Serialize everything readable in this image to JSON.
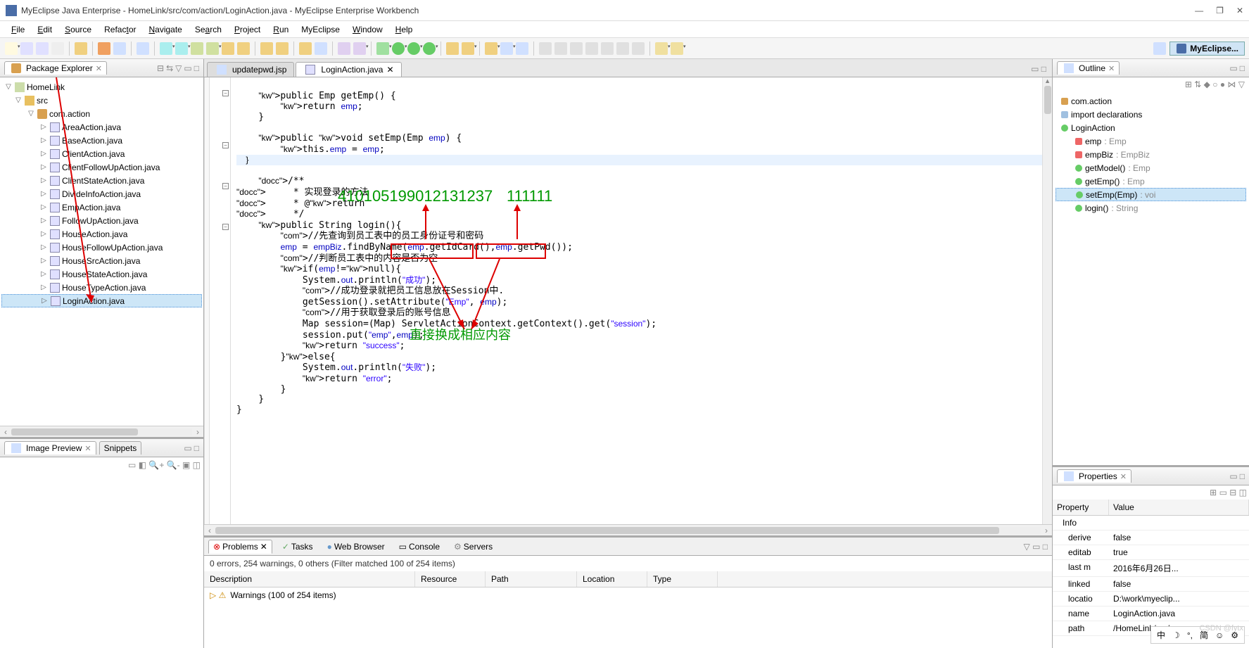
{
  "window": {
    "title": "MyEclipse Java Enterprise - HomeLink/src/com/action/LoginAction.java - MyEclipse Enterprise Workbench",
    "min": "—",
    "max": "❐",
    "close": "✕"
  },
  "menu": [
    "File",
    "Edit",
    "Source",
    "Refactor",
    "Navigate",
    "Search",
    "Project",
    "Run",
    "MyEclipse",
    "Window",
    "Help"
  ],
  "perspective_label": "MyEclipse...",
  "package_explorer": {
    "title": "Package Explorer",
    "project": "HomeLink",
    "src": "src",
    "pkg": "com.action",
    "files": [
      "AreaAction.java",
      "BaseAction.java",
      "ClientAction.java",
      "ClientFollowUpAction.java",
      "ClientStateAction.java",
      "DivideInfoAction.java",
      "EmpAction.java",
      "FollowUpAction.java",
      "HouseAction.java",
      "HouseFollowUpAction.java",
      "HouseSrcAction.java",
      "HouseStateAction.java",
      "HouseTypeAction.java",
      "LoginAction.java"
    ]
  },
  "image_preview": {
    "title": "Image Preview",
    "snippets": "Snippets"
  },
  "editor_tabs": [
    {
      "label": "updatepwd.jsp",
      "active": false
    },
    {
      "label": "LoginAction.java",
      "active": true
    }
  ],
  "code": {
    "lines": [
      "",
      "    public Emp getEmp() {",
      "        return emp;",
      "    }",
      "",
      "    public void setEmp(Emp emp) {",
      "        this.emp = emp;",
      "    }",
      "",
      "    /**",
      "     * 实现登录的方法",
      "     * @return",
      "     */",
      "    public String login(){",
      "        //先查询到员工表中的员工身份证号和密码",
      "        emp = empBiz.findByName(emp.getIdCard(),emp.getPwd());",
      "        //判断员工表中的内容是否为空",
      "        if(emp!=null){",
      "            System.out.println(\"成功\");",
      "            //成功登录就把员工信息放在Session中.",
      "            getSession().setAttribute(\"Emp\", emp);",
      "            //用于获取登录后的账号信息",
      "            Map session=(Map) ServletActionContext.getContext().get(\"session\");",
      "            session.put(\"emp\",emp);",
      "            return \"success\";",
      "        }else{",
      "            System.out.println(\"失败\");",
      "            return \"error\";",
      "        }",
      "    }",
      "}",
      ""
    ]
  },
  "annotations": {
    "num1": "410105199012131237",
    "num2": "111111",
    "text": "直接换成相应内容"
  },
  "problems": {
    "tabs": [
      "Problems",
      "Tasks",
      "Web Browser",
      "Console",
      "Servers"
    ],
    "summary": "0 errors, 254 warnings, 0 others (Filter matched 100 of 254 items)",
    "cols": [
      "Description",
      "Resource",
      "Path",
      "Location",
      "Type"
    ],
    "row1": "Warnings (100 of 254 items)"
  },
  "outline": {
    "title": "Outline",
    "items": [
      {
        "icon": "pkg",
        "label": "com.action",
        "indent": 0
      },
      {
        "icon": "imp",
        "label": "import declarations",
        "indent": 0
      },
      {
        "icon": "cls",
        "label": "LoginAction",
        "indent": 0
      },
      {
        "icon": "fld",
        "label": "emp",
        "suffix": ": Emp",
        "indent": 1
      },
      {
        "icon": "fld",
        "label": "empBiz",
        "suffix": ": EmpBiz",
        "indent": 1
      },
      {
        "icon": "mth",
        "label": "getModel()",
        "suffix": ": Emp",
        "indent": 1
      },
      {
        "icon": "mth",
        "label": "getEmp()",
        "suffix": ": Emp",
        "indent": 1
      },
      {
        "icon": "mth",
        "label": "setEmp(Emp)",
        "suffix": ": voi",
        "indent": 1,
        "sel": true
      },
      {
        "icon": "mth",
        "label": "login()",
        "suffix": ": String",
        "indent": 1
      }
    ]
  },
  "properties": {
    "title": "Properties",
    "cols": [
      "Property",
      "Value"
    ],
    "info": "Info",
    "rows": [
      [
        "derive",
        "false"
      ],
      [
        "editab",
        "true"
      ],
      [
        "last m",
        "2016年6月26日..."
      ],
      [
        "linked",
        "false"
      ],
      [
        "locatio",
        "D:\\work\\myeclip..."
      ],
      [
        "name",
        "LoginAction.java"
      ],
      [
        "path",
        "/HomeLink/src/c..."
      ]
    ]
  },
  "ime": [
    "中",
    "☽",
    "°,",
    "简",
    "☺",
    "⚙"
  ]
}
